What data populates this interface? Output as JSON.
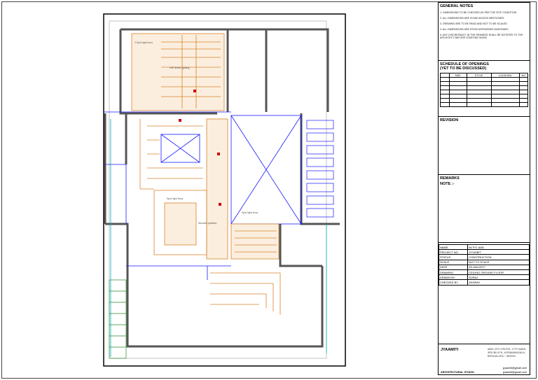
{
  "general_notes": {
    "title": "GENERAL NOTES",
    "items": [
      "1. DIMENSIONS TO BE CHECKED AS PER THE SITE CONDITION",
      "2. ALL DIMENSIONS ARE IN MM UNLESS MENTIONED",
      "3. DRAWING ARE TO BE READ AND NOT TO BE SCALED",
      "4. ALL DIMENSIONS ARE FROM UNFINISHED MASONARY",
      "5. ANY DISCREPANCY IN THE DRAWING SHALL BE NOTIFIED TO THE ARCHITECT BEFORE STARTING WORK"
    ]
  },
  "schedule": {
    "title": "SCHEDULE OF OPENINGS",
    "subtitle": "(YET TO BE DISCUSSED)",
    "columns": [
      "",
      "SIZE",
      "STYLE",
      "LOCATION",
      "NO"
    ],
    "rows": 7
  },
  "revision": {
    "title": "REVISION"
  },
  "remarks": {
    "title": "REMARKS",
    "note": "NOTE :-"
  },
  "info": [
    {
      "label": "NAME",
      "value": "M/ P.S JAIN"
    },
    {
      "label": "PROJECT NO",
      "value": "JY/19/B/T"
    },
    {
      "label": "STATUS",
      "value": "CONSTRUCTION"
    },
    {
      "label": "SCALE",
      "value": "NOT TO SCALE"
    },
    {
      "label": "DATE",
      "value": "29-JAN-2017"
    },
    {
      "label": "DRAWING",
      "value": "CEILING GROUND FLOOR"
    },
    {
      "label": "DRAWN BY",
      "value": "SURAJ"
    },
    {
      "label": "CHECKED BY",
      "value": "ASHRAY"
    }
  ],
  "studio": {
    "name": "JYAAMITI",
    "address1": "#663, 6TH CROSS, 17TH MAIN,",
    "address2": "3RD BLOCK, KORAMANGALA,",
    "address3": "BENGALURU - 560034",
    "email1": "jyaamiti@gmail.com",
    "email2": "jyaamiti@gmail.com",
    "type": "ARCHITECTURAL STUDIO"
  },
  "plan_labels": {
    "spot1": "2 Spot light 4nos",
    "spot2": "Spot light 3nos",
    "wood": "Wooden partition",
    "light1": "LED linear lighting",
    "spot3": "Spot light 4nos"
  }
}
